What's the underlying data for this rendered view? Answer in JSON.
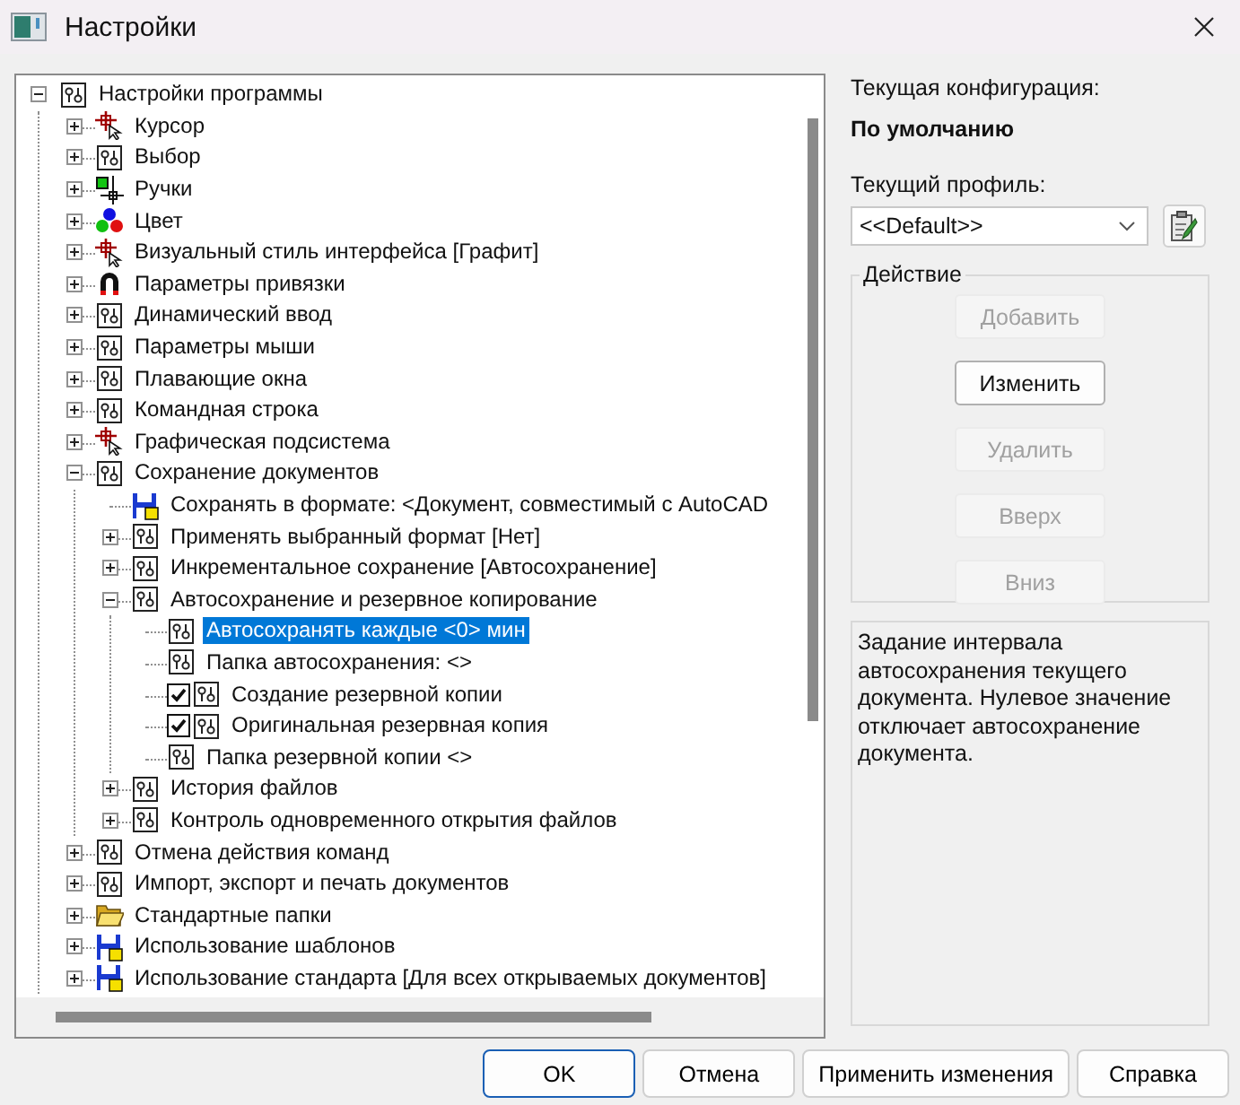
{
  "window": {
    "title": "Настройки"
  },
  "tree": {
    "root": {
      "label": "Настройки программы",
      "kind": "option",
      "expanded": true,
      "selected": false,
      "children": [
        {
          "label": "Курсор",
          "kind": "cursor",
          "expanded": false,
          "selected": false
        },
        {
          "label": "Выбор",
          "kind": "option",
          "expanded": false,
          "selected": false
        },
        {
          "label": "Ручки",
          "kind": "grips",
          "expanded": false,
          "selected": false
        },
        {
          "label": "Цвет",
          "kind": "color",
          "expanded": false,
          "selected": false
        },
        {
          "label": "Визуальный стиль интерфейса [Графит]",
          "kind": "cursor",
          "expanded": false,
          "selected": false
        },
        {
          "label": "Параметры привязки",
          "kind": "snap",
          "expanded": false,
          "selected": false
        },
        {
          "label": "Динамический ввод",
          "kind": "option",
          "expanded": false,
          "selected": false
        },
        {
          "label": "Параметры мыши",
          "kind": "option",
          "expanded": false,
          "selected": false
        },
        {
          "label": "Плавающие окна",
          "kind": "option",
          "expanded": false,
          "selected": false
        },
        {
          "label": "Командная строка",
          "kind": "option",
          "expanded": false,
          "selected": false
        },
        {
          "label": "Графическая подсистема",
          "kind": "cursor",
          "expanded": false,
          "selected": false
        },
        {
          "label": "Сохранение документов",
          "kind": "option",
          "expanded": true,
          "selected": false,
          "children": [
            {
              "label": "Сохранять в формате: <Документ, совместимый с AutoCAD",
              "kind": "save",
              "selected": false
            },
            {
              "label": "Применять выбранный формат [Нет]",
              "kind": "option",
              "expanded": false,
              "selected": false
            },
            {
              "label": "Инкрементальное сохранение [Автосохранение]",
              "kind": "option",
              "expanded": false,
              "selected": false
            },
            {
              "label": "Автосохранение и резервное копирование",
              "kind": "option",
              "expanded": true,
              "selected": false,
              "children": [
                {
                  "label": "Автосохранять каждые <0> мин",
                  "kind": "option",
                  "selected": true
                },
                {
                  "label": "Папка автосохранения: <>",
                  "kind": "option",
                  "selected": false
                },
                {
                  "label": "Создание резервной копии",
                  "kind": "option",
                  "checked": true,
                  "selected": false
                },
                {
                  "label": "Оригинальная  резервная копия",
                  "kind": "option",
                  "checked": true,
                  "selected": false
                },
                {
                  "label": "Папка резервной копии <>",
                  "kind": "option",
                  "selected": false
                }
              ]
            },
            {
              "label": "История файлов",
              "kind": "option",
              "expanded": false,
              "selected": false
            },
            {
              "label": "Контроль одновременного открытия файлов",
              "kind": "option",
              "expanded": false,
              "selected": false
            }
          ]
        },
        {
          "label": "Отмена действия команд",
          "kind": "option",
          "expanded": false,
          "selected": false
        },
        {
          "label": "Импорт, экспорт и печать документов",
          "kind": "option",
          "expanded": false,
          "selected": false
        },
        {
          "label": "Стандартные папки",
          "kind": "folder",
          "expanded": false,
          "selected": false
        },
        {
          "label": "Использование шаблонов",
          "kind": "save",
          "expanded": false,
          "selected": false
        },
        {
          "label": "Использование стандарта [Для всех открываемых документов]",
          "kind": "save",
          "expanded": false,
          "selected": false
        }
      ]
    }
  },
  "config": {
    "label": "Текущая конфигурация:",
    "value": "По умолчанию"
  },
  "profile": {
    "label": "Текущий профиль:",
    "value": "<<Default>>"
  },
  "actions": {
    "legend": "Действие",
    "buttons": [
      {
        "label": "Добавить",
        "disabled": true
      },
      {
        "label": "Изменить",
        "disabled": false
      },
      {
        "label": "Удалить",
        "disabled": true
      },
      {
        "label": "Вверх",
        "disabled": true
      },
      {
        "label": "Вниз",
        "disabled": true
      }
    ]
  },
  "description": "Задание интервала автосохранения текущего документа. Нулевое значение отключает автосохранение документа.",
  "buttons": [
    {
      "label": "OK",
      "default": true
    },
    {
      "label": "Отмена",
      "default": false
    },
    {
      "label": "Применить изменения",
      "default": false
    },
    {
      "label": "Справка",
      "default": false
    }
  ]
}
